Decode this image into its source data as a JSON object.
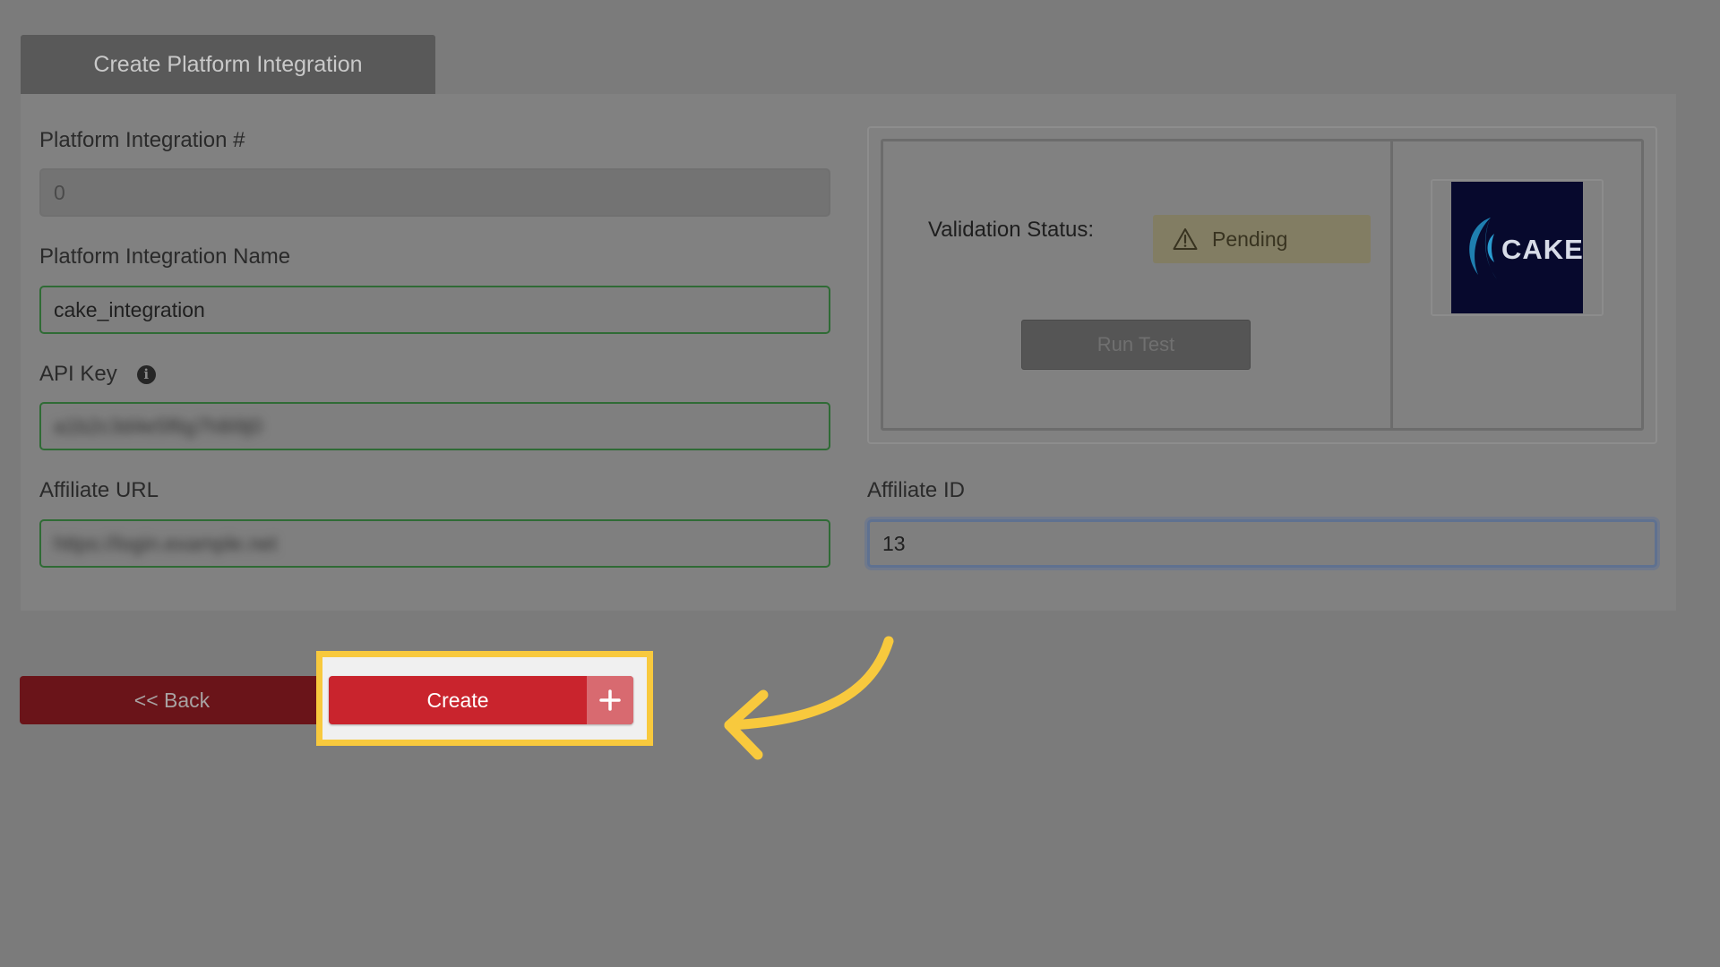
{
  "header": {
    "tab_title": "Create Platform Integration"
  },
  "form": {
    "integration_number": {
      "label": "Platform Integration #",
      "value": "0"
    },
    "integration_name": {
      "label": "Platform Integration Name",
      "value": "cake_integration"
    },
    "api_key": {
      "label": "API Key",
      "info_icon": "info-icon",
      "value": "a1b2c3d4e5f6g7h8i9j0"
    },
    "affiliate_url": {
      "label": "Affiliate URL",
      "value": "https://login.example.net"
    },
    "affiliate_id": {
      "label": "Affiliate ID",
      "value": "13"
    }
  },
  "validation": {
    "status_label": "Validation Status:",
    "status_value": "Pending",
    "status_icon": "warning-icon",
    "run_test_label": "Run Test"
  },
  "logo": {
    "text": "CAKE",
    "colors": {
      "background": "#07092d",
      "mark": "#1f7fb0"
    }
  },
  "actions": {
    "back_label": "<< Back",
    "create_label": "Create",
    "create_icon": "plus-icon"
  },
  "colors": {
    "highlight": "#f8c93d",
    "create_button": "#c9242d",
    "back_button": "#6a1419"
  }
}
